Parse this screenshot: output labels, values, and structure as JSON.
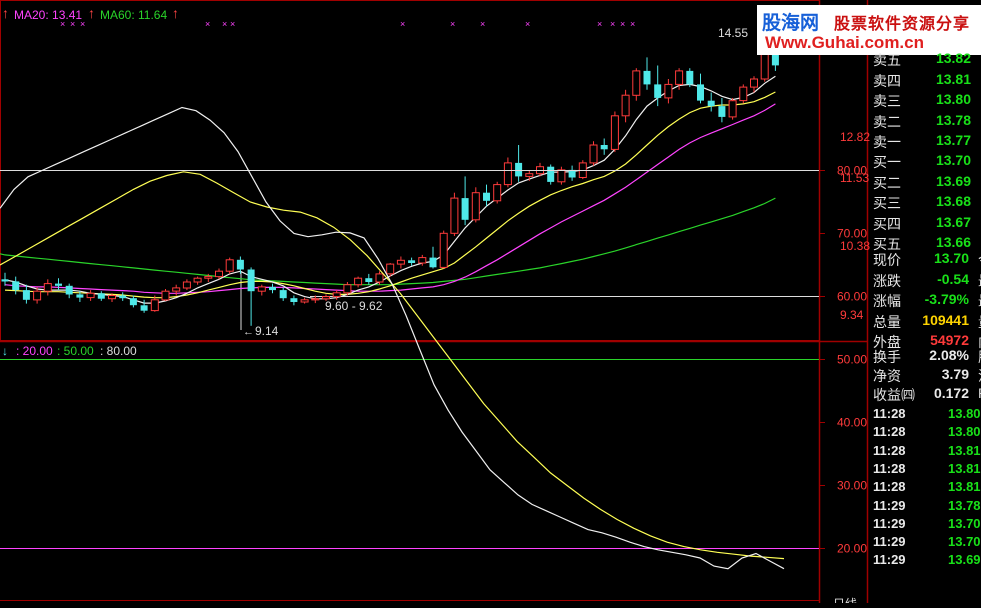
{
  "top_legend": {
    "ma20": "MA20: 13.41",
    "ma60": "MA60: 11.64"
  },
  "price_labels": [
    "14.55",
    "12.82",
    "11.53",
    "10.38",
    "9.34"
  ],
  "annotations": {
    "low": "9.14",
    "range": "9.60 - 9.62"
  },
  "indicator_legend": {
    "a": ": 20.00",
    "b": ": 50.00",
    "c": ": 80.00"
  },
  "indicator_ticks": [
    "80.00",
    "70.00",
    "60.00",
    "50.00",
    "40.00",
    "30.00",
    "20.00"
  ],
  "logo": {
    "name": "股海网",
    "slogan": "股票软件资源分享",
    "url": "Www.Guhai.com.cn"
  },
  "quotes": {
    "sell": [
      {
        "label": "卖五",
        "price": "13.82"
      },
      {
        "label": "卖四",
        "price": "13.81"
      },
      {
        "label": "卖三",
        "price": "13.80"
      },
      {
        "label": "卖二",
        "price": "13.78"
      },
      {
        "label": "卖一",
        "price": "13.77"
      }
    ],
    "buy": [
      {
        "label": "买一",
        "price": "13.70"
      },
      {
        "label": "买二",
        "price": "13.69"
      },
      {
        "label": "买三",
        "price": "13.68"
      },
      {
        "label": "买四",
        "price": "13.67"
      },
      {
        "label": "买五",
        "price": "13.66"
      }
    ],
    "stats": [
      {
        "label": "现价",
        "value": "13.70",
        "color": "green",
        "cut": "今"
      },
      {
        "label": "涨跌",
        "value": "-0.54",
        "color": "green",
        "cut": "最"
      },
      {
        "label": "涨幅",
        "value": "-3.79%",
        "color": "green",
        "cut": "最"
      },
      {
        "label": "总量",
        "value": "109441",
        "color": "yellow",
        "cut": "量"
      },
      {
        "label": "外盘",
        "value": "54972",
        "color": "red",
        "cut": "内"
      },
      {
        "label": "换手",
        "value": "2.08%",
        "color": "white",
        "cut": "股"
      },
      {
        "label": "净资",
        "value": "3.79",
        "color": "white",
        "cut": "流"
      },
      {
        "label": "收益㈣",
        "value": "0.172",
        "color": "white",
        "cut": "P"
      }
    ],
    "ticks": [
      {
        "time": "11:28",
        "price": "13.80"
      },
      {
        "time": "11:28",
        "price": "13.80"
      },
      {
        "time": "11:28",
        "price": "13.81"
      },
      {
        "time": "11:28",
        "price": "13.81"
      },
      {
        "time": "11:28",
        "price": "13.81"
      },
      {
        "time": "11:29",
        "price": "13.78"
      },
      {
        "time": "11:29",
        "price": "13.70"
      },
      {
        "time": "11:29",
        "price": "13.70"
      },
      {
        "time": "11:29",
        "price": "13.69"
      }
    ]
  },
  "colors": {
    "up": "#ff3b3b",
    "down": "#4fe8e8",
    "ma_fast": "#f0f0f0",
    "ma_mid": "#ffff55",
    "ma20": "#ff44ff",
    "ma60": "#2ad42a",
    "grid": "#a00000"
  },
  "chart_data": [
    {
      "type": "candlestick",
      "title": "",
      "ylim": [
        9.0,
        14.8
      ],
      "price_ticks": [
        14.55,
        12.82,
        11.53,
        10.38,
        9.34
      ],
      "support_line": 9.6,
      "candles": [
        [
          10.0,
          10.12,
          9.88,
          9.96
        ],
        [
          9.96,
          10.05,
          9.72,
          9.8
        ],
        [
          9.8,
          9.9,
          9.55,
          9.62
        ],
        [
          9.62,
          9.85,
          9.55,
          9.78
        ],
        [
          9.78,
          10.0,
          9.7,
          9.92
        ],
        [
          9.92,
          10.02,
          9.8,
          9.88
        ],
        [
          9.88,
          9.92,
          9.65,
          9.72
        ],
        [
          9.72,
          9.78,
          9.58,
          9.66
        ],
        [
          9.66,
          9.8,
          9.6,
          9.74
        ],
        [
          9.74,
          9.78,
          9.6,
          9.64
        ],
        [
          9.64,
          9.74,
          9.58,
          9.7
        ],
        [
          9.7,
          9.76,
          9.6,
          9.65
        ],
        [
          9.65,
          9.7,
          9.48,
          9.52
        ],
        [
          9.52,
          9.62,
          9.38,
          9.42
        ],
        [
          9.42,
          9.7,
          9.4,
          9.62
        ],
        [
          9.62,
          9.82,
          9.6,
          9.78
        ],
        [
          9.78,
          9.9,
          9.7,
          9.84
        ],
        [
          9.84,
          10.0,
          9.8,
          9.95
        ],
        [
          9.95,
          10.05,
          9.9,
          10.02
        ],
        [
          10.02,
          10.1,
          9.95,
          10.05
        ],
        [
          10.05,
          10.2,
          10.0,
          10.15
        ],
        [
          10.15,
          10.4,
          10.1,
          10.36
        ],
        [
          10.36,
          10.42,
          10.1,
          10.18
        ],
        [
          10.18,
          10.22,
          9.14,
          9.78
        ],
        [
          9.78,
          9.9,
          9.7,
          9.86
        ],
        [
          9.86,
          9.92,
          9.74,
          9.8
        ],
        [
          9.8,
          9.85,
          9.6,
          9.65
        ],
        [
          9.65,
          9.7,
          9.52,
          9.58
        ],
        [
          9.58,
          9.66,
          9.55,
          9.62
        ],
        [
          9.62,
          9.7,
          9.56,
          9.64
        ],
        [
          9.64,
          9.72,
          9.6,
          9.68
        ],
        [
          9.68,
          9.8,
          9.62,
          9.75
        ],
        [
          9.75,
          9.95,
          9.7,
          9.9
        ],
        [
          9.9,
          10.05,
          9.85,
          10.02
        ],
        [
          10.02,
          10.1,
          9.9,
          9.95
        ],
        [
          9.95,
          10.15,
          9.9,
          10.1
        ],
        [
          10.1,
          10.3,
          10.05,
          10.28
        ],
        [
          10.28,
          10.42,
          10.2,
          10.35
        ],
        [
          10.35,
          10.4,
          10.25,
          10.3
        ],
        [
          10.3,
          10.45,
          10.25,
          10.4
        ],
        [
          10.4,
          10.6,
          10.2,
          10.22
        ],
        [
          10.22,
          10.9,
          10.2,
          10.85
        ],
        [
          10.85,
          11.6,
          10.8,
          11.5
        ],
        [
          11.5,
          11.9,
          11.0,
          11.1
        ],
        [
          11.1,
          11.7,
          11.05,
          11.6
        ],
        [
          11.6,
          11.75,
          11.35,
          11.45
        ],
        [
          11.45,
          11.8,
          11.4,
          11.75
        ],
        [
          11.75,
          12.25,
          11.7,
          12.15
        ],
        [
          12.15,
          12.48,
          11.8,
          11.9
        ],
        [
          11.9,
          12.0,
          11.82,
          11.95
        ],
        [
          11.95,
          12.15,
          11.9,
          12.08
        ],
        [
          12.08,
          12.12,
          11.75,
          11.8
        ],
        [
          11.8,
          12.08,
          11.75,
          12.02
        ],
        [
          12.02,
          12.1,
          11.82,
          11.88
        ],
        [
          11.88,
          12.2,
          11.85,
          12.15
        ],
        [
          12.15,
          12.55,
          12.1,
          12.48
        ],
        [
          12.48,
          12.6,
          12.3,
          12.4
        ],
        [
          12.4,
          13.1,
          12.35,
          13.02
        ],
        [
          13.02,
          13.5,
          12.9,
          13.4
        ],
        [
          13.4,
          13.9,
          13.3,
          13.85
        ],
        [
          13.85,
          14.1,
          13.5,
          13.6
        ],
        [
          13.6,
          13.95,
          13.2,
          13.35
        ],
        [
          13.35,
          13.7,
          13.25,
          13.6
        ],
        [
          13.6,
          13.9,
          13.5,
          13.85
        ],
        [
          13.85,
          13.9,
          13.55,
          13.6
        ],
        [
          13.6,
          13.8,
          13.25,
          13.3
        ],
        [
          13.3,
          13.45,
          13.1,
          13.2
        ],
        [
          13.2,
          13.35,
          12.9,
          13.0
        ],
        [
          13.0,
          13.35,
          12.95,
          13.3
        ],
        [
          13.3,
          13.6,
          13.25,
          13.55
        ],
        [
          13.55,
          13.75,
          13.45,
          13.7
        ],
        [
          13.7,
          14.3,
          13.65,
          14.2
        ],
        [
          14.2,
          14.4,
          13.85,
          13.95
        ]
      ],
      "ma_fast": [
        9.99,
        9.95,
        9.88,
        9.82,
        9.8,
        9.8,
        9.8,
        9.78,
        9.74,
        9.72,
        9.7,
        9.68,
        9.62,
        9.56,
        9.56,
        9.6,
        9.66,
        9.74,
        9.84,
        9.92,
        10.0,
        10.1,
        10.15,
        10.05,
        10.0,
        9.95,
        9.88,
        9.75,
        9.68,
        9.64,
        9.64,
        9.66,
        9.72,
        9.8,
        9.86,
        9.95,
        10.06,
        10.16,
        10.24,
        10.3,
        10.33,
        10.45,
        10.7,
        10.95,
        11.15,
        11.35,
        11.5,
        11.65,
        11.78,
        11.85,
        11.92,
        11.98,
        11.98,
        11.99,
        12.02,
        12.1,
        12.2,
        12.4,
        12.65,
        12.95,
        13.2,
        13.35,
        13.48,
        13.58,
        13.6,
        13.56,
        13.48,
        13.38,
        13.32,
        13.36,
        13.45,
        13.62,
        13.75
      ],
      "ma_mid": [
        9.8,
        9.79,
        9.78,
        9.77,
        9.77,
        9.77,
        9.76,
        9.75,
        9.74,
        9.73,
        9.72,
        9.71,
        9.69,
        9.67,
        9.66,
        9.66,
        9.68,
        9.71,
        9.75,
        9.8,
        9.85,
        9.9,
        9.94,
        9.96,
        9.96,
        9.95,
        9.92,
        9.88,
        9.83,
        9.78,
        9.74,
        9.72,
        9.72,
        9.74,
        9.77,
        9.82,
        9.88,
        9.95,
        10.02,
        10.08,
        10.14,
        10.2,
        10.3,
        10.45,
        10.6,
        10.76,
        10.92,
        11.08,
        11.22,
        11.35,
        11.46,
        11.56,
        11.64,
        11.71,
        11.77,
        11.84,
        11.9,
        12.0,
        12.13,
        12.3,
        12.48,
        12.66,
        12.82,
        12.96,
        13.08,
        13.16,
        13.2,
        13.22,
        13.22,
        13.24,
        13.28,
        13.36,
        13.46
      ],
      "ma20": [
        9.9,
        9.88,
        9.87,
        9.86,
        9.86,
        9.85,
        9.84,
        9.83,
        9.82,
        9.81,
        9.8,
        9.79,
        9.78,
        9.76,
        9.75,
        9.74,
        9.74,
        9.75,
        9.76,
        9.77,
        9.79,
        9.81,
        9.83,
        9.84,
        9.85,
        9.85,
        9.85,
        9.84,
        9.83,
        9.82,
        9.81,
        9.8,
        9.79,
        9.78,
        9.78,
        9.78,
        9.79,
        9.8,
        9.82,
        9.84,
        9.86,
        9.9,
        9.96,
        10.04,
        10.14,
        10.25,
        10.36,
        10.48,
        10.6,
        10.72,
        10.84,
        10.95,
        11.06,
        11.16,
        11.26,
        11.36,
        11.46,
        11.58,
        11.7,
        11.84,
        11.98,
        12.12,
        12.26,
        12.4,
        12.52,
        12.62,
        12.7,
        12.78,
        12.86,
        12.94,
        13.02,
        13.12,
        13.24
      ],
      "ma60": [
        10.45,
        10.43,
        10.41,
        10.39,
        10.37,
        10.35,
        10.33,
        10.31,
        10.29,
        10.27,
        10.25,
        10.23,
        10.21,
        10.19,
        10.17,
        10.15,
        10.13,
        10.11,
        10.09,
        10.07,
        10.05,
        10.03,
        10.01,
        9.99,
        9.98,
        9.97,
        9.96,
        9.95,
        9.94,
        9.93,
        9.92,
        9.91,
        9.9,
        9.9,
        9.9,
        9.9,
        9.9,
        9.91,
        9.92,
        9.93,
        9.94,
        9.96,
        9.98,
        10.0,
        10.03,
        10.06,
        10.09,
        10.12,
        10.15,
        10.18,
        10.21,
        10.25,
        10.29,
        10.33,
        10.37,
        10.42,
        10.47,
        10.52,
        10.58,
        10.64,
        10.7,
        10.76,
        10.82,
        10.88,
        10.94,
        11.0,
        11.06,
        11.12,
        11.18,
        11.25,
        11.32,
        11.4,
        11.5
      ]
    },
    {
      "type": "line",
      "title": "",
      "ylim": [
        10,
        90
      ],
      "hlines": [
        20,
        50,
        80
      ],
      "series": [
        {
          "values": [
            74,
            77,
            79,
            80,
            81,
            82,
            83,
            84,
            85,
            86,
            87,
            88,
            89,
            90,
            89.5,
            88,
            86,
            83,
            79,
            75,
            72,
            70,
            69.5,
            69.8,
            70.2,
            70.1,
            69.3,
            66,
            62,
            57,
            51.5,
            46,
            42,
            38.5,
            35.5,
            32.5,
            30.5,
            28.5,
            27,
            26,
            25,
            24,
            23,
            22.5,
            21.8,
            21,
            20.3,
            19.8,
            19.4,
            19,
            18.5,
            17.2,
            16.8,
            18.5,
            19.2,
            18,
            16.8
          ]
        },
        {
          "values": [
            65,
            66.5,
            68,
            69.5,
            71,
            72.5,
            74,
            75.5,
            77,
            78.3,
            79.2,
            79.8,
            79.4,
            78,
            76.5,
            75,
            74.2,
            73.7,
            73.4,
            72.5,
            71,
            69,
            66.5,
            63.5,
            60.5,
            57,
            53.5,
            50,
            46.5,
            43,
            40,
            37,
            34.5,
            32,
            30,
            28,
            26.2,
            24.6,
            23.2,
            22,
            21,
            20.3,
            19.8,
            19.4,
            19.1,
            18.8,
            18.6,
            18.4
          ]
        }
      ]
    }
  ]
}
